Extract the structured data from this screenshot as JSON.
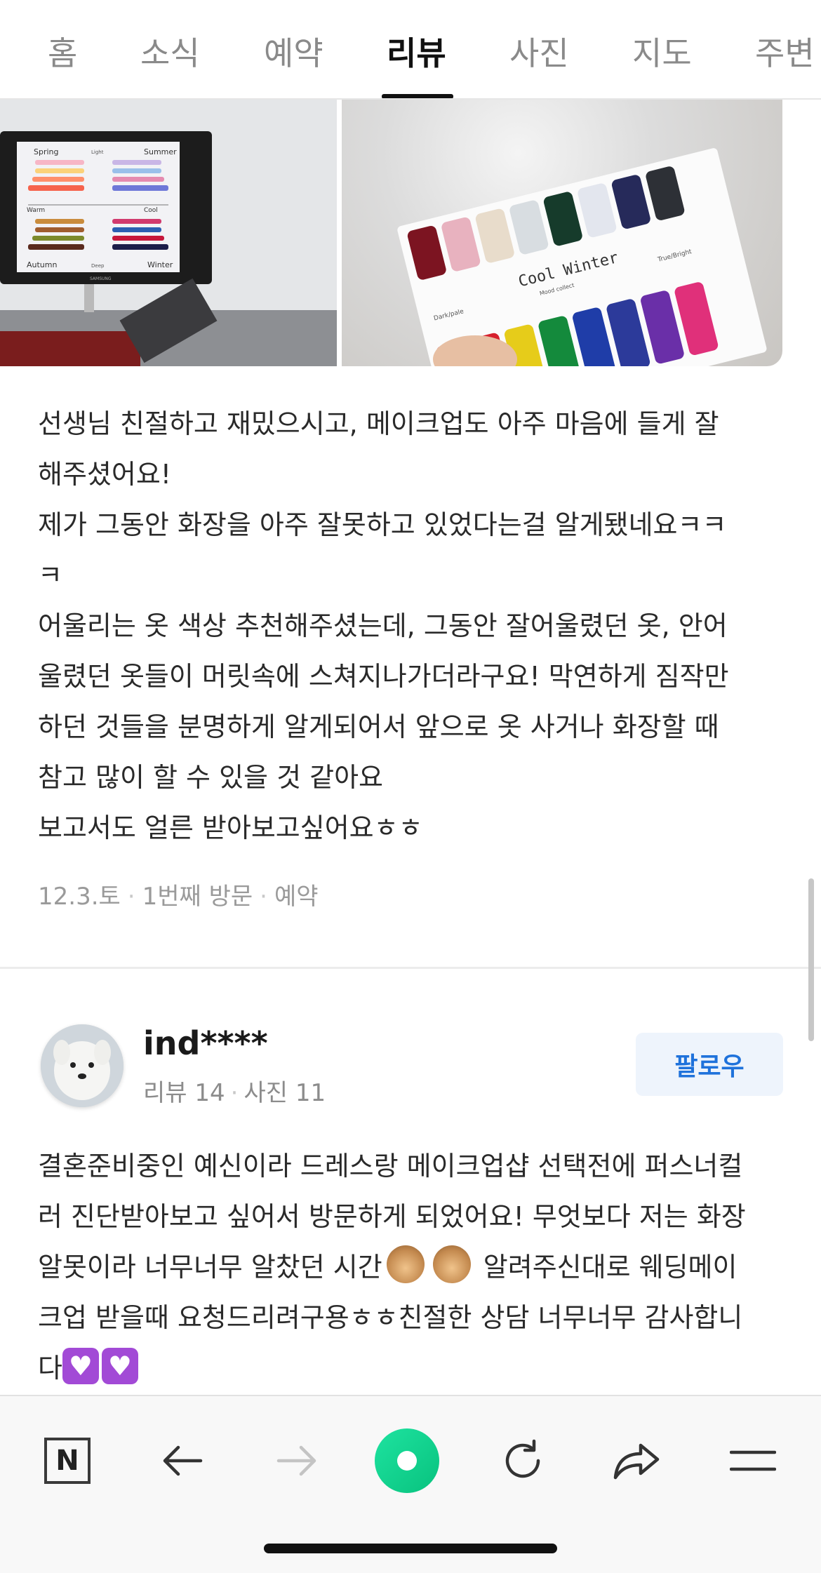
{
  "tabs": [
    {
      "label": "홈",
      "active": false
    },
    {
      "label": "소식",
      "active": false
    },
    {
      "label": "예약",
      "active": false
    },
    {
      "label": "리뷰",
      "active": true
    },
    {
      "label": "사진",
      "active": false
    },
    {
      "label": "지도",
      "active": false
    },
    {
      "label": "주변",
      "active": false
    }
  ],
  "review1": {
    "photo_left_labels": {
      "spring": "Spring",
      "summer": "Summer",
      "warm": "Warm",
      "cool": "Cool",
      "autumn": "Autumn",
      "winter": "Winter",
      "light": "Light",
      "deep": "Deep",
      "brand": "SAMSUNG"
    },
    "photo_right_labels": {
      "title": "Cool Winter",
      "left": "Dark/pale",
      "right": "True/Bright",
      "sub": "Mood collect"
    },
    "lines": [
      "선생님 친절하고 재밌으시고, 메이크업도 아주 마음에 들게 잘\n해주셨어요!",
      "제가 그동안 화장을 아주 잘못하고 있었다는걸 알게됐네요ㅋㅋ\nㅋ",
      "어울리는 옷 색상 추천해주셨는데, 그동안 잘어울렸던 옷, 안어\n울렸던 옷들이 머릿속에 스쳐지나가더라구요! 막연하게 짐작만\n하던 것들을 분명하게 알게되어서 앞으로 옷 사거나 화장할 때\n참고 많이 할 수 있을 것 같아요",
      "보고서도 얼른 받아보고싶어요ㅎㅎ"
    ],
    "meta": {
      "date": "12.3.토",
      "visit": "1번째 방문",
      "type": "예약"
    }
  },
  "review2": {
    "username": "ind****",
    "stats": {
      "reviews": "리뷰 14",
      "photos": "사진 11"
    },
    "follow_label": "팔로우",
    "text_part1": "결혼준비중인 예신이라 드레스랑 메이크업샵 선택전에 퍼스너컬\n러 진단받아보고 싶어서 방문하게 되었어요! 무엇보다 저는 화장\n알못이라 너무너무 알찼던 시간",
    "text_part2": " 알려주신대로 웨딩메이\n크업 받을때 요청드리려구용ㅎㅎ친절한 상담 너무너무 감사합니\n다"
  },
  "toolbar": {
    "n_label": "N",
    "icons": [
      "naver-n-icon",
      "back-arrow-icon",
      "forward-arrow-icon",
      "home-circle-icon",
      "reload-icon",
      "share-icon",
      "menu-icon"
    ]
  },
  "colors": {
    "accent_blue": "#1f72db",
    "green": "#08c27e",
    "heart_purple": "#a24ad6"
  }
}
